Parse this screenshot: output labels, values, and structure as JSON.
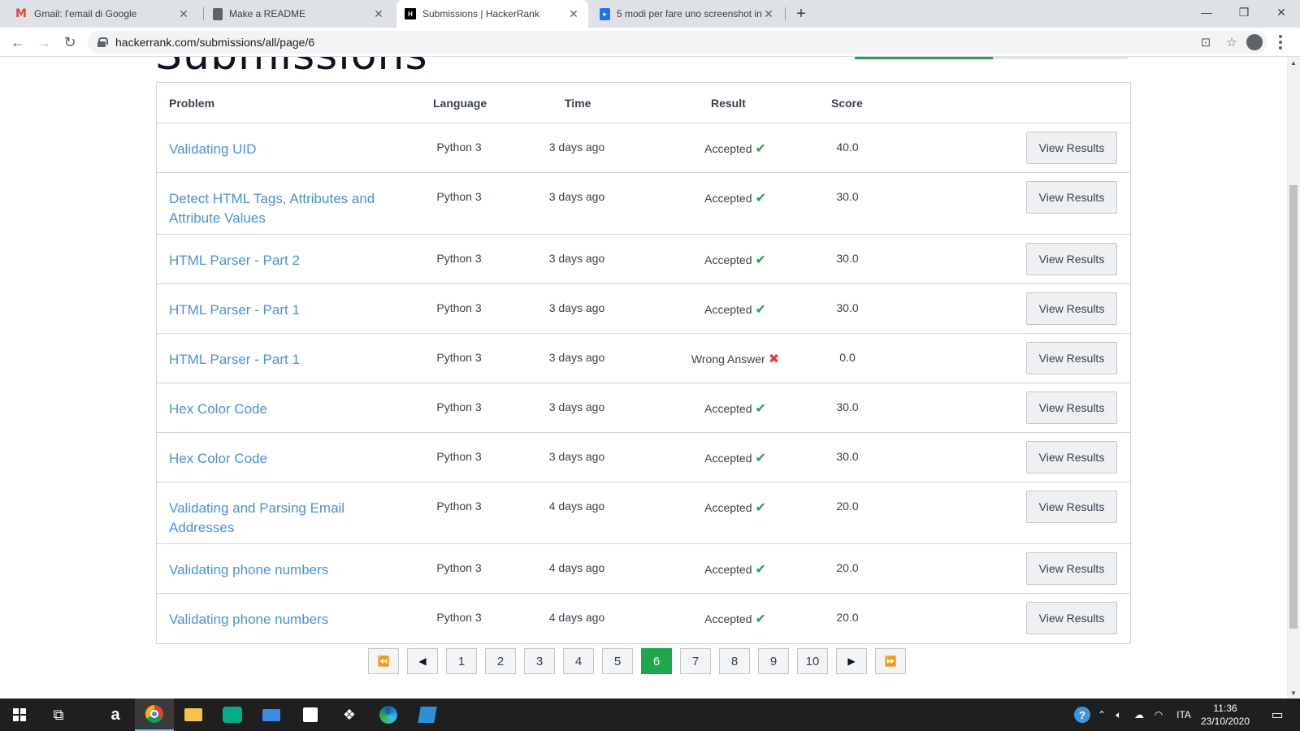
{
  "browser": {
    "tabs": [
      {
        "title": "Gmail: l'email di Google",
        "icon": "gmail-icon"
      },
      {
        "title": "Make a README",
        "icon": "document-icon"
      },
      {
        "title": "Submissions | HackerRank",
        "icon": "hackerrank-icon",
        "active": true
      },
      {
        "title": "5 modi per fare uno screenshot in",
        "icon": "slides-icon"
      }
    ],
    "url": "hackerrank.com/submissions/all/page/6"
  },
  "page": {
    "title": "Submissions",
    "columns": {
      "problem": "Problem",
      "language": "Language",
      "time": "Time",
      "result": "Result",
      "score": "Score"
    },
    "view_label": "View Results",
    "rows": [
      {
        "problem": "Validating UID",
        "language": "Python 3",
        "time": "3 days ago",
        "result": "Accepted",
        "status": "accepted",
        "score": "40.0"
      },
      {
        "problem": "Detect HTML Tags, Attributes and Attribute Values",
        "language": "Python 3",
        "time": "3 days ago",
        "result": "Accepted",
        "status": "accepted",
        "score": "30.0"
      },
      {
        "problem": "HTML Parser - Part 2",
        "language": "Python 3",
        "time": "3 days ago",
        "result": "Accepted",
        "status": "accepted",
        "score": "30.0"
      },
      {
        "problem": "HTML Parser - Part 1",
        "language": "Python 3",
        "time": "3 days ago",
        "result": "Accepted",
        "status": "accepted",
        "score": "30.0"
      },
      {
        "problem": "HTML Parser - Part 1",
        "language": "Python 3",
        "time": "3 days ago",
        "result": "Wrong Answer",
        "status": "wrong",
        "score": "0.0"
      },
      {
        "problem": "Hex Color Code",
        "language": "Python 3",
        "time": "3 days ago",
        "result": "Accepted",
        "status": "accepted",
        "score": "30.0"
      },
      {
        "problem": "Hex Color Code",
        "language": "Python 3",
        "time": "3 days ago",
        "result": "Accepted",
        "status": "accepted",
        "score": "30.0"
      },
      {
        "problem": "Validating and Parsing Email Addresses",
        "language": "Python 3",
        "time": "4 days ago",
        "result": "Accepted",
        "status": "accepted",
        "score": "20.0"
      },
      {
        "problem": "Validating phone numbers",
        "language": "Python 3",
        "time": "4 days ago",
        "result": "Accepted",
        "status": "accepted",
        "score": "20.0"
      },
      {
        "problem": "Validating phone numbers",
        "language": "Python 3",
        "time": "4 days ago",
        "result": "Accepted",
        "status": "accepted",
        "score": "20.0"
      }
    ],
    "pagination": {
      "pages": [
        "1",
        "2",
        "3",
        "4",
        "5",
        "6",
        "7",
        "8",
        "9",
        "10"
      ],
      "current": "6",
      "first": "⏪",
      "prev": "◀",
      "next": "▶",
      "last": "⏩"
    }
  },
  "taskbar": {
    "language": "ITA",
    "time": "11:36",
    "date": "23/10/2020"
  },
  "colors": {
    "accent": "#1ba94c",
    "link": "#4a90e2",
    "error": "#e94141"
  }
}
